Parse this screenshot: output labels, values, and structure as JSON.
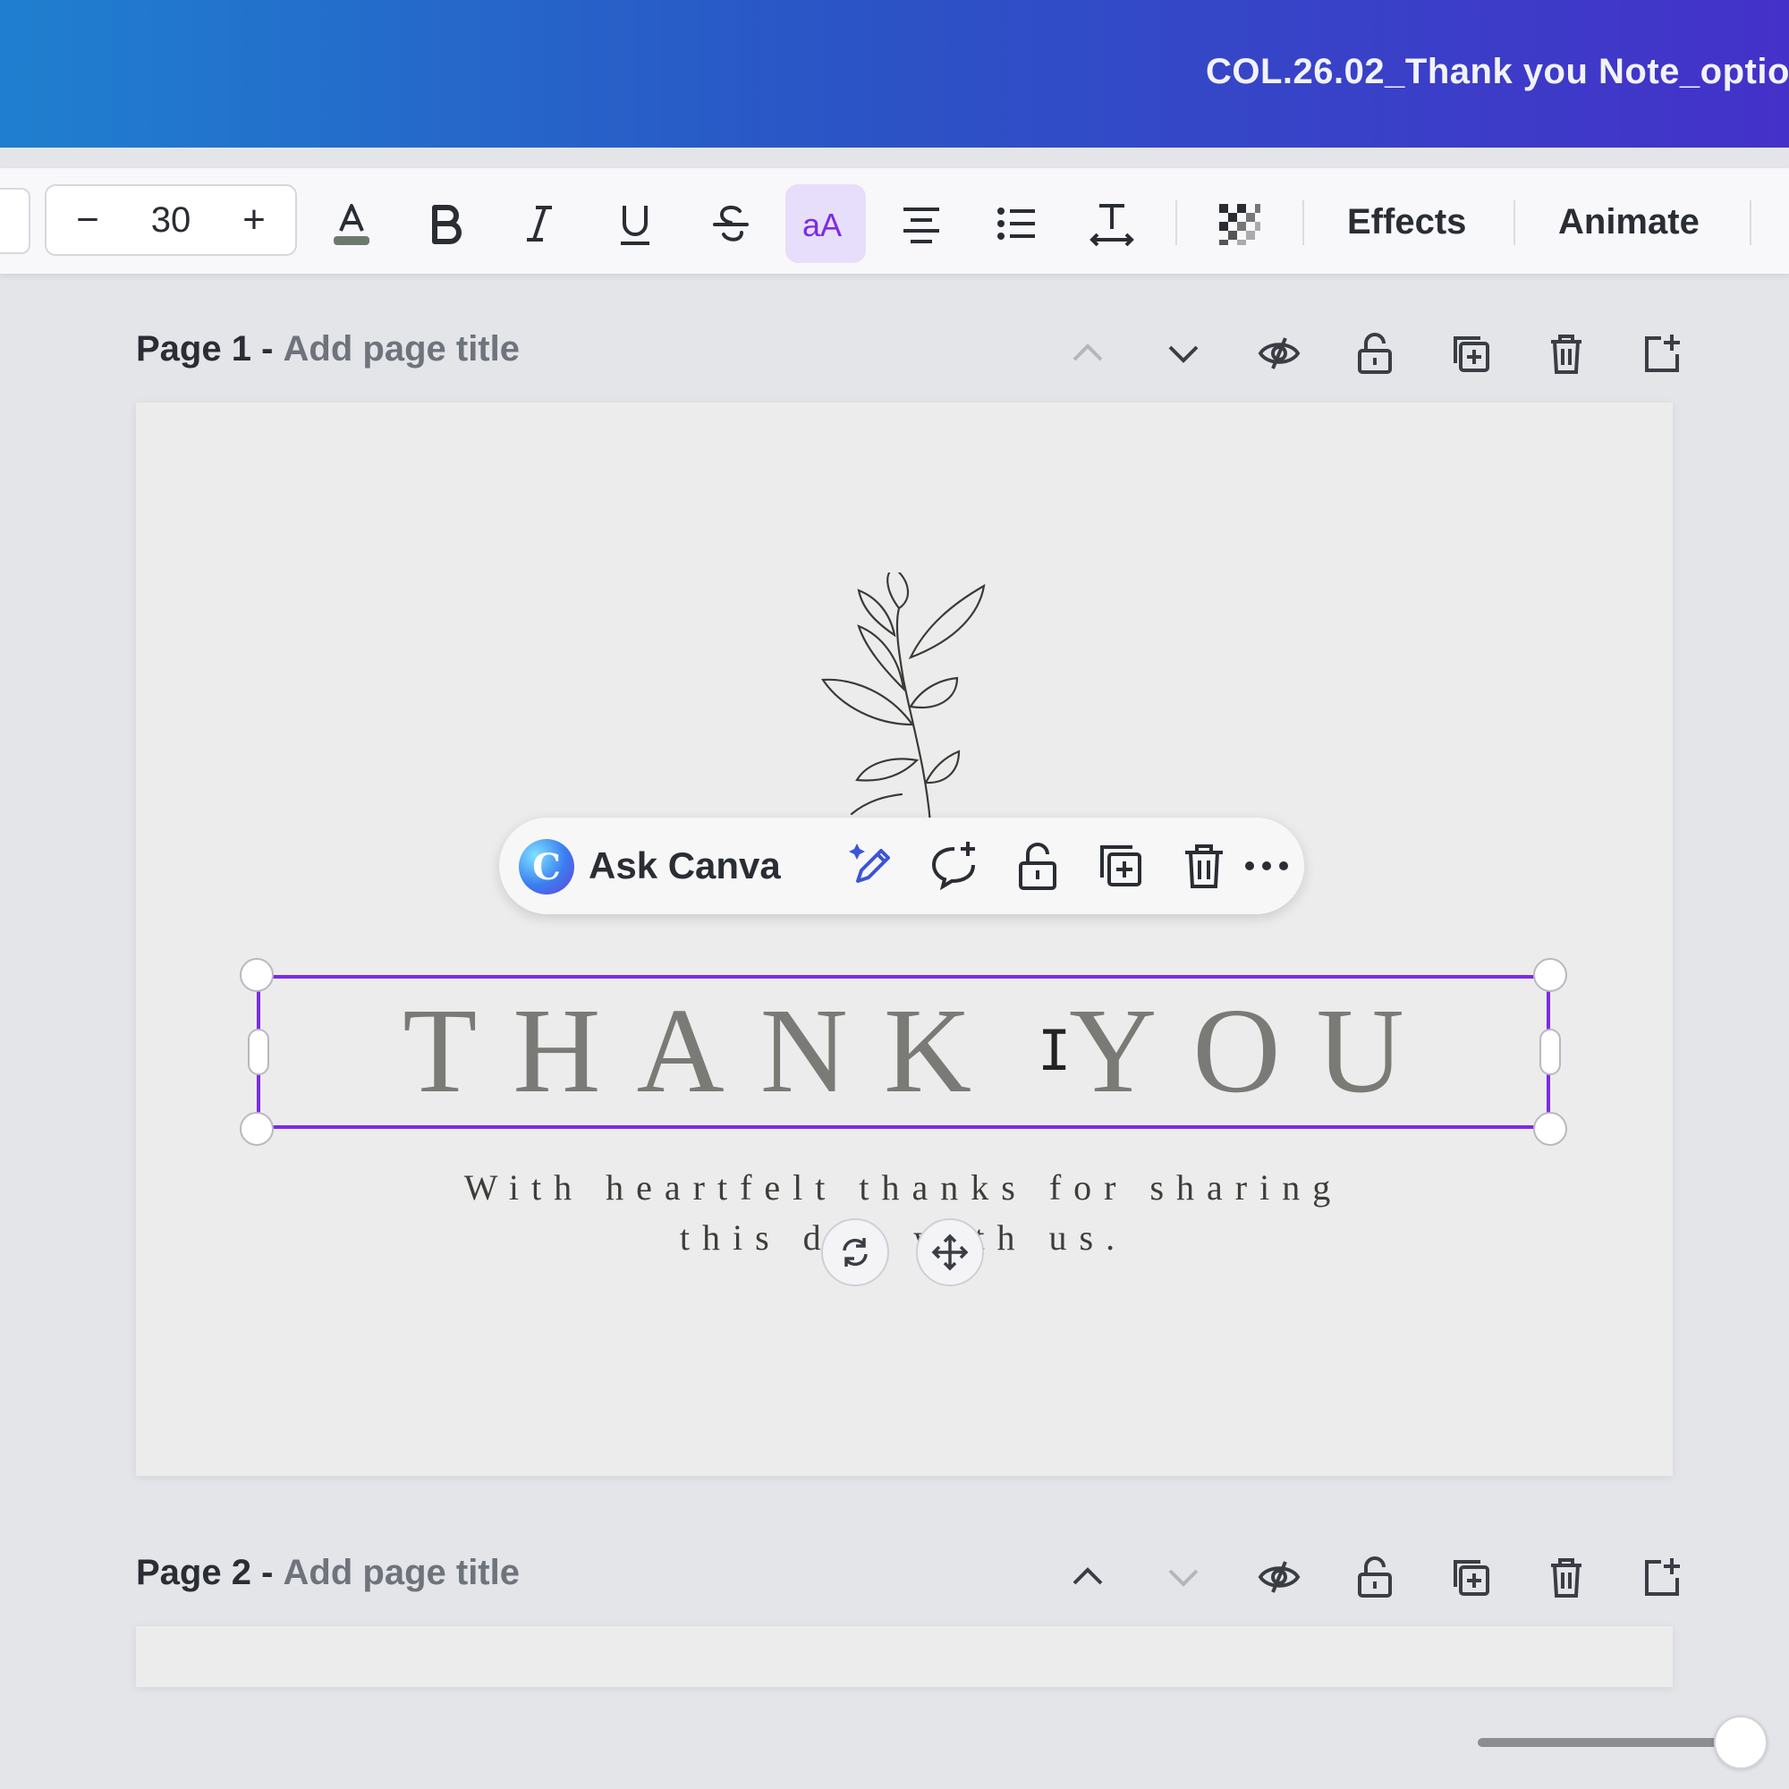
{
  "header": {
    "doc_title": "COL.26.02_Thank you Note_optio"
  },
  "toolbar": {
    "font_size": "30",
    "decrease_label": "−",
    "increase_label": "+",
    "effects_label": "Effects",
    "animate_label": "Animate",
    "text_color": "#6b7a6b",
    "active_tool": "case-toggle"
  },
  "pages": [
    {
      "name": "Page 1 -",
      "title_placeholder": "Add page title"
    },
    {
      "name": "Page 2 -",
      "title_placeholder": "Add page title"
    }
  ],
  "context_menu": {
    "ask_label": "Ask Canva",
    "logo_letter": "C"
  },
  "canvas": {
    "headline": "THANK YOU",
    "subtitle_line1": "With heartfelt thanks for sharing",
    "subtitle_line2": "this day with us."
  },
  "colors": {
    "selection": "#7d2ae8",
    "header_gradient_start": "#1f7fcf",
    "header_gradient_end": "#4431c9"
  }
}
